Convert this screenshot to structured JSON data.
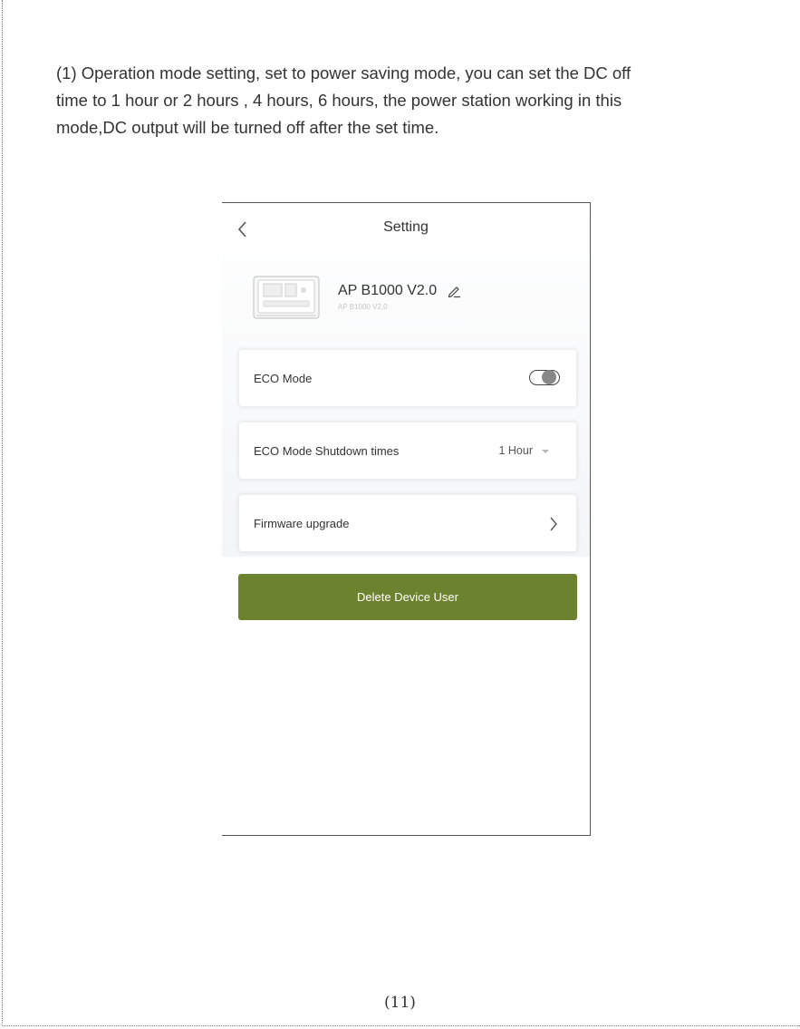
{
  "intro": {
    "line1": "(1)  Operation mode setting, set to power saving mode, you can set the  DC off",
    "line2": "time to 1 hour or 2 hours , 4 hours, 6 hours, the power station working in this",
    "line3": "mode,DC output will be turned off after the set time."
  },
  "screen": {
    "title": "Setting",
    "device": {
      "name": "AP B1000 V2.0",
      "subtitle": "AP B1000 V2.0"
    },
    "eco_mode": {
      "label": "ECO Mode",
      "enabled": false
    },
    "shutdown": {
      "label": "ECO Mode Shutdown times",
      "value": "1 Hour"
    },
    "firmware": {
      "label": "Firmware upgrade"
    },
    "delete_button": "Delete Device User",
    "accent_color": "#6c822e"
  },
  "page_number": "(11)"
}
